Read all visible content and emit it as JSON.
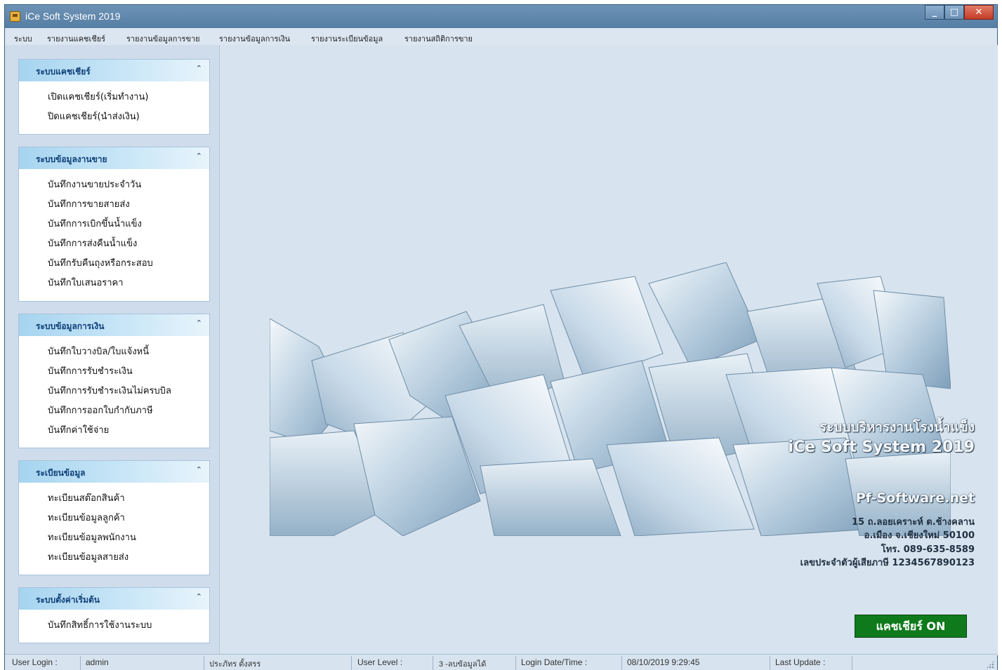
{
  "window": {
    "title": "iCe Soft System 2019",
    "controls": {
      "minimize": "_",
      "maximize": "□",
      "close": "✕"
    }
  },
  "menu": {
    "items": [
      "ระบบ",
      "รายงานแคชเชียร์",
      "รายงานข้อมูลการขาย",
      "รายงานข้อมูลการเงิน",
      "รายงานระเบียนข้อมูล",
      "รายงานสถิติการขาย"
    ]
  },
  "sidebar": {
    "sections": [
      {
        "title": "ระบบแคชเชียร์",
        "items": [
          "เปิดแคชเชียร์(เริ่มทำงาน)",
          "ปิดแคชเชียร์(นำส่งเงิน)"
        ]
      },
      {
        "title": "ระบบข้อมูลงานขาย",
        "items": [
          "บันทึกงานขายประจำวัน",
          "บันทึกการขายสายส่ง",
          "บันทึกการเบิกขึ้นน้ำแข็ง",
          "บันทึกการส่งคืนน้ำแข็ง",
          "บันทึกรับคืนถุงหรือกระสอบ",
          "บันทึกใบเสนอราคา"
        ]
      },
      {
        "title": "ระบบข้อมูลการเงิน",
        "items": [
          "บันทึกใบวางบิล/ใบแจ้งหนี้",
          "บันทึกการรับชำระเงิน",
          "บันทึกการรับชำระเงินไม่ครบบิล",
          "บันทึกการออกใบกำกับภาษี",
          "บันทึกค่าใช้จ่าย"
        ]
      },
      {
        "title": "ระเบียนข้อมูล",
        "items": [
          "ทะเบียนสต๊อกสินค้า",
          "ทะเบียนข้อมูลลูกค้า",
          "ทะเบียนข้อมูลพนักงาน",
          "ทะเบียนข้อมูลสายส่ง"
        ]
      },
      {
        "title": "ระบบตั้งค่าเริ่มต้น",
        "items": [
          "บันทึกสิทธิ์การใช้งานระบบ"
        ]
      }
    ],
    "collapse_glyph": "⌃"
  },
  "company": {
    "name": "ระบบบริหารงานโรงน้ำแข็ง",
    "system": "iCe Soft System 2019",
    "website": "Pf-Software.net",
    "address1": "15 ถ.ลอยเคราะห์ ต.ช้างคลาน",
    "address2": "อ.เมือง จ.เชียงใหม่ 50100",
    "phone": "โทร. 089-635-8589",
    "tax_id": "เลขประจำตัวผู้เสียภาษี 1234567890123"
  },
  "cashier_button": {
    "label": "แคชเชียร์ ON",
    "color": "#0f7a1c"
  },
  "status": {
    "user_login_label": "User Login :",
    "user_login": "admin",
    "user_name": "ประภัทร ตั้งสรร",
    "user_level_label": "User Level :",
    "user_level": "3 -ลบข้อมูลได้",
    "login_dt_label": "Login Date/Time :",
    "login_dt": "08/10/2019 9:29:45",
    "last_update_label": "Last Update :"
  },
  "icons": {
    "app": "app-icon",
    "section": "chevron-up-icon",
    "grip": "resize-grip-icon"
  }
}
